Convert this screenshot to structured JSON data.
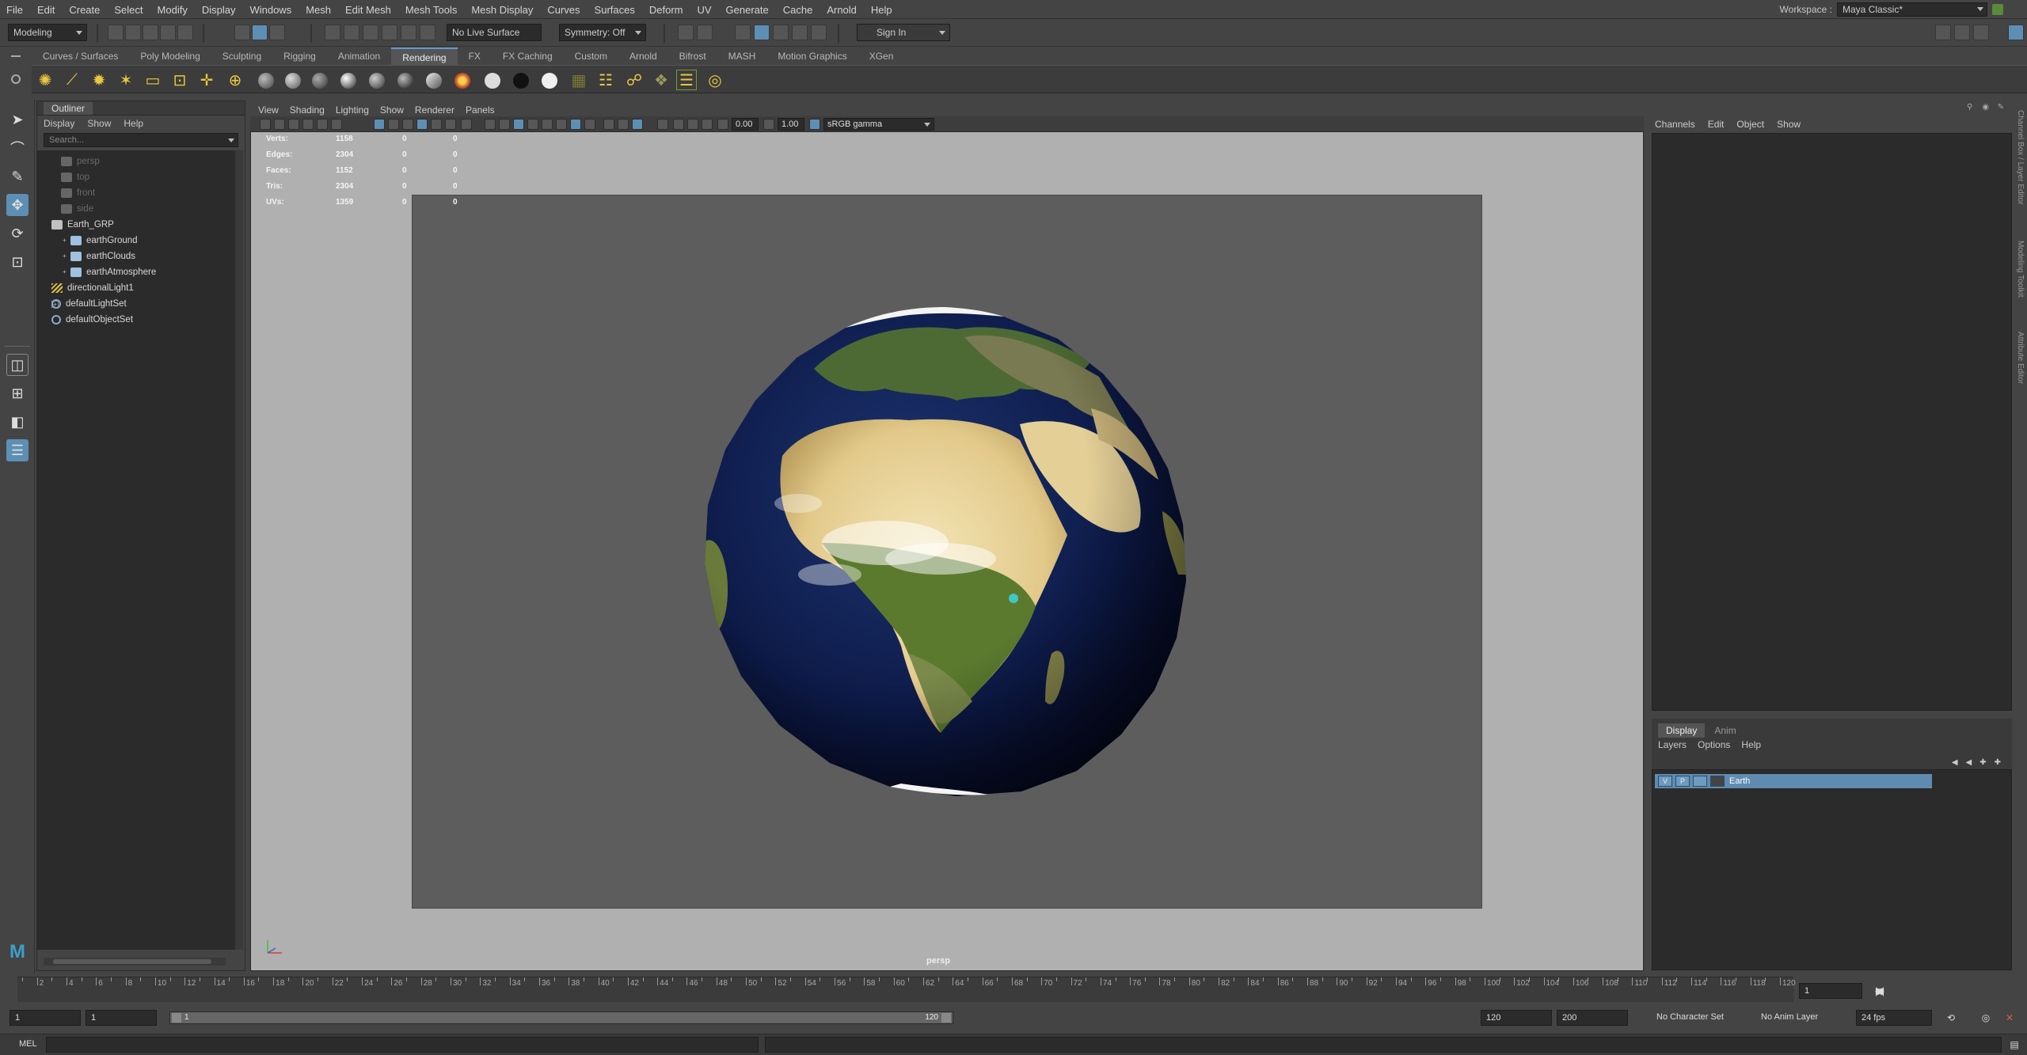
{
  "menubar": {
    "items": [
      "File",
      "Edit",
      "Create",
      "Select",
      "Modify",
      "Display",
      "Windows",
      "Mesh",
      "Edit Mesh",
      "Mesh Tools",
      "Mesh Display",
      "Curves",
      "Surfaces",
      "Deform",
      "UV",
      "Generate",
      "Cache",
      "Arnold",
      "Help"
    ],
    "workspace_label": "Workspace :",
    "workspace_value": "Maya Classic*"
  },
  "statusline": {
    "mode": "Modeling",
    "live_surface": "No Live Surface",
    "symmetry": "Symmetry: Off",
    "sign_in": "Sign In"
  },
  "shelf": {
    "tabs": [
      "Curves / Surfaces",
      "Poly Modeling",
      "Sculpting",
      "Rigging",
      "Animation",
      "Rendering",
      "FX",
      "FX Caching",
      "Custom",
      "Arnold",
      "Bifrost",
      "MASH",
      "Motion Graphics",
      "XGen"
    ],
    "active_tab": "Rendering"
  },
  "outliner": {
    "title": "Outliner",
    "menu": [
      "Display",
      "Show",
      "Help"
    ],
    "search_placeholder": "Search...",
    "items": [
      {
        "label": "persp",
        "dim": true
      },
      {
        "label": "top",
        "dim": true
      },
      {
        "label": "front",
        "dim": true
      },
      {
        "label": "side",
        "dim": true
      },
      {
        "label": "Earth_GRP",
        "dim": false
      },
      {
        "label": "earthGround",
        "dim": false
      },
      {
        "label": "earthClouds",
        "dim": false
      },
      {
        "label": "earthAtmosphere",
        "dim": false
      },
      {
        "label": "directionalLight1",
        "dim": false
      },
      {
        "label": "defaultLightSet",
        "dim": false
      },
      {
        "label": "defaultObjectSet",
        "dim": false
      }
    ]
  },
  "viewport": {
    "menu": [
      "View",
      "Shading",
      "Lighting",
      "Show",
      "Renderer",
      "Panels"
    ],
    "exposure": "0.00",
    "gamma": "1.00",
    "color_space": "sRGB gamma",
    "camera": "persp",
    "hud": [
      {
        "label": "Verts:",
        "v1": "1158",
        "v2": "0",
        "v3": "0"
      },
      {
        "label": "Edges:",
        "v1": "2304",
        "v2": "0",
        "v3": "0"
      },
      {
        "label": "Faces:",
        "v1": "1152",
        "v2": "0",
        "v3": "0"
      },
      {
        "label": "Tris:",
        "v1": "2304",
        "v2": "0",
        "v3": "0"
      },
      {
        "label": "UVs:",
        "v1": "1359",
        "v2": "0",
        "v3": "0"
      }
    ]
  },
  "channelbox": {
    "menu": [
      "Channels",
      "Edit",
      "Object",
      "Show"
    ],
    "side_tabs": [
      "Channel Box / Layer Editor",
      "Modeling Toolkit",
      "Attribute Editor"
    ]
  },
  "layers": {
    "tabs": [
      "Display",
      "Anim"
    ],
    "menu": [
      "Layers",
      "Options",
      "Help"
    ],
    "layer_name": "Earth",
    "v_flag": "V",
    "p_flag": "P"
  },
  "timeline": {
    "ticks": [
      "2",
      "4",
      "6",
      "8",
      "10",
      "12",
      "14",
      "16",
      "18",
      "20",
      "22",
      "24",
      "26",
      "28",
      "30",
      "32",
      "34",
      "36",
      "38",
      "40",
      "42",
      "44",
      "46",
      "48",
      "50",
      "52",
      "54",
      "56",
      "58",
      "60",
      "62",
      "64",
      "66",
      "68",
      "70",
      "72",
      "74",
      "76",
      "78",
      "80",
      "82",
      "84",
      "86",
      "88",
      "90",
      "92",
      "94",
      "96",
      "98",
      "100",
      "102",
      "104",
      "106",
      "108",
      "110",
      "112",
      "114",
      "116",
      "118",
      "120"
    ],
    "current_frame": "1",
    "current_frame_field": "1"
  },
  "range": {
    "start": "1",
    "playback_start": "1",
    "slider_start": "1",
    "slider_end": "120",
    "playback_end": "120",
    "end": "200",
    "character_set": "No Character Set",
    "anim_layer": "No Anim Layer",
    "fps": "24 fps"
  },
  "cmdline": {
    "lang": "MEL"
  },
  "colors": {
    "accent": "#5d8fb5",
    "panel": "#444444",
    "field": "#2b2b2b"
  }
}
